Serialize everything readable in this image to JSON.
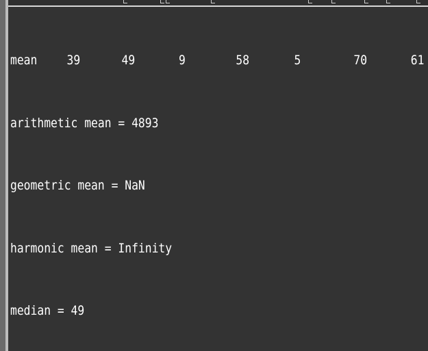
{
  "console": {
    "first_line": [
      "mean",
      "39",
      "49",
      "9",
      "58",
      "5",
      "70",
      "61"
    ],
    "lines": [
      "arithmetic mean = 4893",
      "geometric mean = NaN",
      "harmonic mean = Infinity",
      "median = 49"
    ]
  }
}
